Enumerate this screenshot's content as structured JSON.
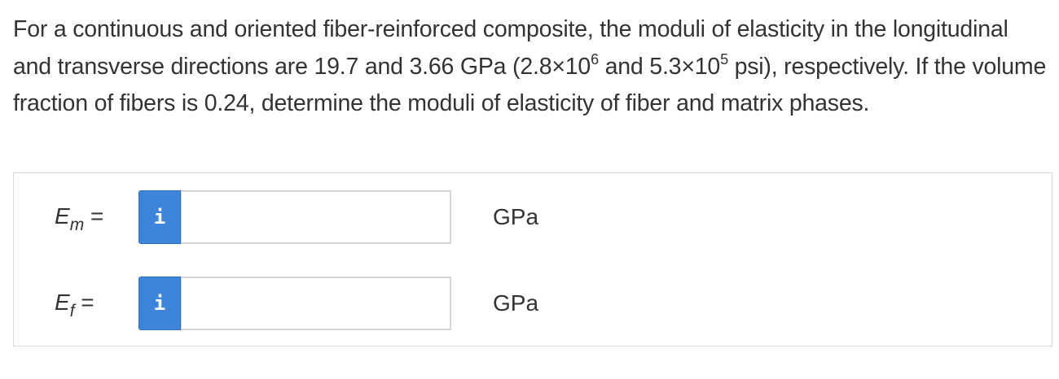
{
  "question": {
    "part1": "For a continuous and oriented fiber-reinforced composite, the moduli of elasticity in the longitudinal and transverse directions are 19.7 and 3.66 GPa (2.8×10",
    "exp1": "6",
    "part2": " and 5.3×10",
    "exp2": "5",
    "part3": " psi), respectively. If the volume fraction of fibers is 0.24, determine the moduli of elasticity of fiber and matrix phases."
  },
  "answers": [
    {
      "symbol": "E",
      "subscript": "m",
      "equals": " =",
      "info_label": "i",
      "value": "",
      "unit": "GPa"
    },
    {
      "symbol": "E",
      "subscript": "f",
      "equals": " =",
      "info_label": "i",
      "value": "",
      "unit": "GPa"
    }
  ],
  "colors": {
    "info_button": "#3d84db",
    "text": "#333333",
    "panel_border": "#d9d9d9"
  }
}
